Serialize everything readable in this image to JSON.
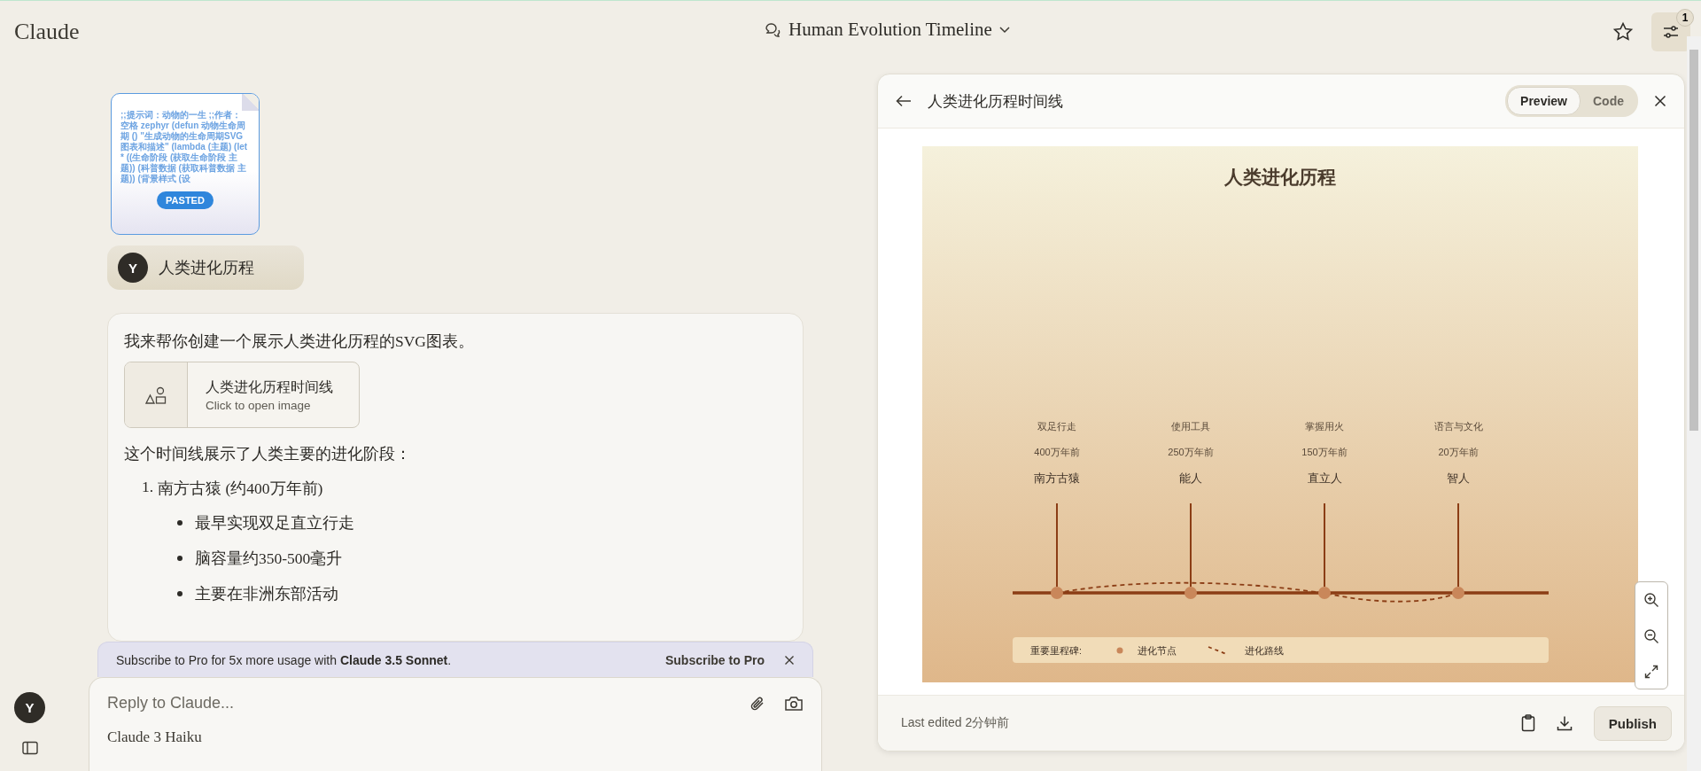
{
  "app": {
    "logo": "Claude"
  },
  "header": {
    "title": "Human Evolution Timeline",
    "badge": "1"
  },
  "pasted": {
    "preview": ";;提示词：动物的一生 ;;作者：空格 zephyr (defun 动物生命周期 () \"生成动物的生命周期SVG图表和描述\" (lambda (主题) (let* ((生命阶段 (获取生命阶段 主题)) (科普数据 (获取科普数据 主题)) (背景样式 (设",
    "tag": "PASTED"
  },
  "user_message": {
    "avatar": "Y",
    "text": "人类进化历程"
  },
  "assistant": {
    "intro": "我来帮你创建一个展示人类进化历程的SVG图表。",
    "artifact": {
      "title": "人类进化历程时间线",
      "subtitle": "Click to open image"
    },
    "lead": "这个时间线展示了人类主要的进化阶段：",
    "list": [
      {
        "number": "1.",
        "text": "南方古猿 (约400万年前)",
        "bullets": [
          "最早实现双足直立行走",
          "脑容量约350-500毫升",
          "主要在非洲东部活动"
        ]
      }
    ]
  },
  "banner": {
    "text": "Subscribe to Pro for 5x more usage with **Claude 3.5 Sonnet**.",
    "action": "Subscribe to Pro"
  },
  "composer": {
    "placeholder": "Reply to Claude...",
    "model": "Claude 3 Haiku"
  },
  "sidebar": {
    "avatar": "Y"
  },
  "panel": {
    "title": "人类进化历程时间线",
    "tabs": [
      {
        "label": "Preview",
        "selected": true
      },
      {
        "label": "Code",
        "selected": false
      }
    ],
    "diagram": {
      "title": "人类进化历程",
      "milestones": [
        {
          "event": "双足行走",
          "time": "400万年前",
          "species": "南方古猿"
        },
        {
          "event": "使用工具",
          "time": "250万年前",
          "species": "能人"
        },
        {
          "event": "掌握用火",
          "time": "150万年前",
          "species": "直立人"
        },
        {
          "event": "语言与文化",
          "time": "20万年前",
          "species": "智人"
        }
      ],
      "legend": {
        "title": "重要里程碑:",
        "node": "进化节点",
        "route": "进化路线"
      }
    },
    "footer": "Last edited 2分钟前",
    "publish": "Publish"
  }
}
